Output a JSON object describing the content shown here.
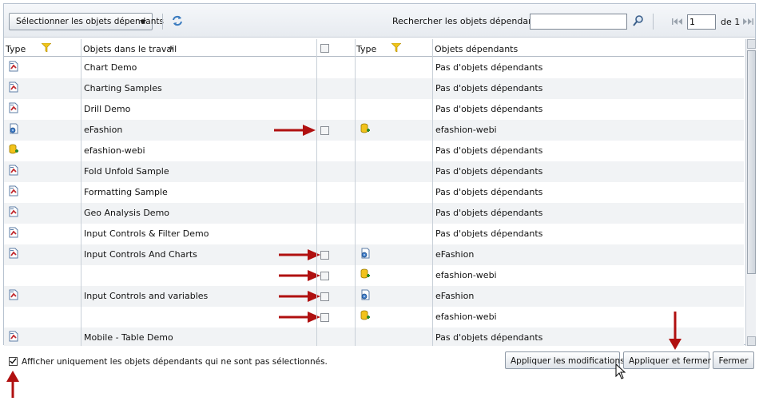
{
  "toolbar": {
    "select_label": "Sélectionner les objets dépendants",
    "search_label": "Rechercher les objets dépendants",
    "search_value": "",
    "page_value": "1",
    "page_of": "de 1"
  },
  "columns": {
    "type1": "Type",
    "objects": "Objets dans le travail",
    "type2": "Type",
    "dependents": "Objets dépendants"
  },
  "rows": [
    {
      "icon": "report",
      "name": "Chart Demo",
      "check": false,
      "dep_icon": "",
      "dep": "Pas d'objets dépendants"
    },
    {
      "icon": "report",
      "name": "Charting Samples",
      "check": false,
      "dep_icon": "",
      "dep": "Pas d'objets dépendants"
    },
    {
      "icon": "report",
      "name": "Drill Demo",
      "check": false,
      "dep_icon": "",
      "dep": "Pas d'objets dépendants"
    },
    {
      "icon": "universe-doc",
      "name": "eFashion",
      "check": true,
      "dep_icon": "universe",
      "dep": "efashion-webi"
    },
    {
      "icon": "universe",
      "name": "efashion-webi",
      "check": false,
      "dep_icon": "",
      "dep": "Pas d'objets dépendants"
    },
    {
      "icon": "report",
      "name": "Fold Unfold Sample",
      "check": false,
      "dep_icon": "",
      "dep": "Pas d'objets dépendants"
    },
    {
      "icon": "report",
      "name": "Formatting Sample",
      "check": false,
      "dep_icon": "",
      "dep": "Pas d'objets dépendants"
    },
    {
      "icon": "report",
      "name": "Geo Analysis Demo",
      "check": false,
      "dep_icon": "",
      "dep": "Pas d'objets dépendants"
    },
    {
      "icon": "report",
      "name": "Input Controls & Filter Demo",
      "check": false,
      "dep_icon": "",
      "dep": "Pas d'objets dépendants"
    },
    {
      "icon": "report",
      "name": "Input Controls And Charts",
      "check": true,
      "dep_icon": "universe-doc",
      "dep": "eFashion"
    },
    {
      "icon": "",
      "name": "",
      "check": true,
      "dep_icon": "universe",
      "dep": "efashion-webi"
    },
    {
      "icon": "report",
      "name": "Input Controls and variables",
      "check": true,
      "dep_icon": "universe-doc",
      "dep": "eFashion"
    },
    {
      "icon": "",
      "name": "",
      "check": true,
      "dep_icon": "universe",
      "dep": "efashion-webi"
    },
    {
      "icon": "report",
      "name": "Mobile - Table Demo",
      "check": false,
      "dep_icon": "",
      "dep": "Pas d'objets dépendants"
    }
  ],
  "footer": {
    "only_unselected_label": "Afficher uniquement les objets dépendants qui ne sont pas sélectionnés.",
    "only_unselected_checked": true,
    "apply_label": "Appliquer les modifications",
    "apply_close_label": "Appliquer et fermer",
    "close_label": "Fermer"
  },
  "colors": {
    "annotation_arrow": "#b01010",
    "filter_icon": "#f0c419"
  }
}
